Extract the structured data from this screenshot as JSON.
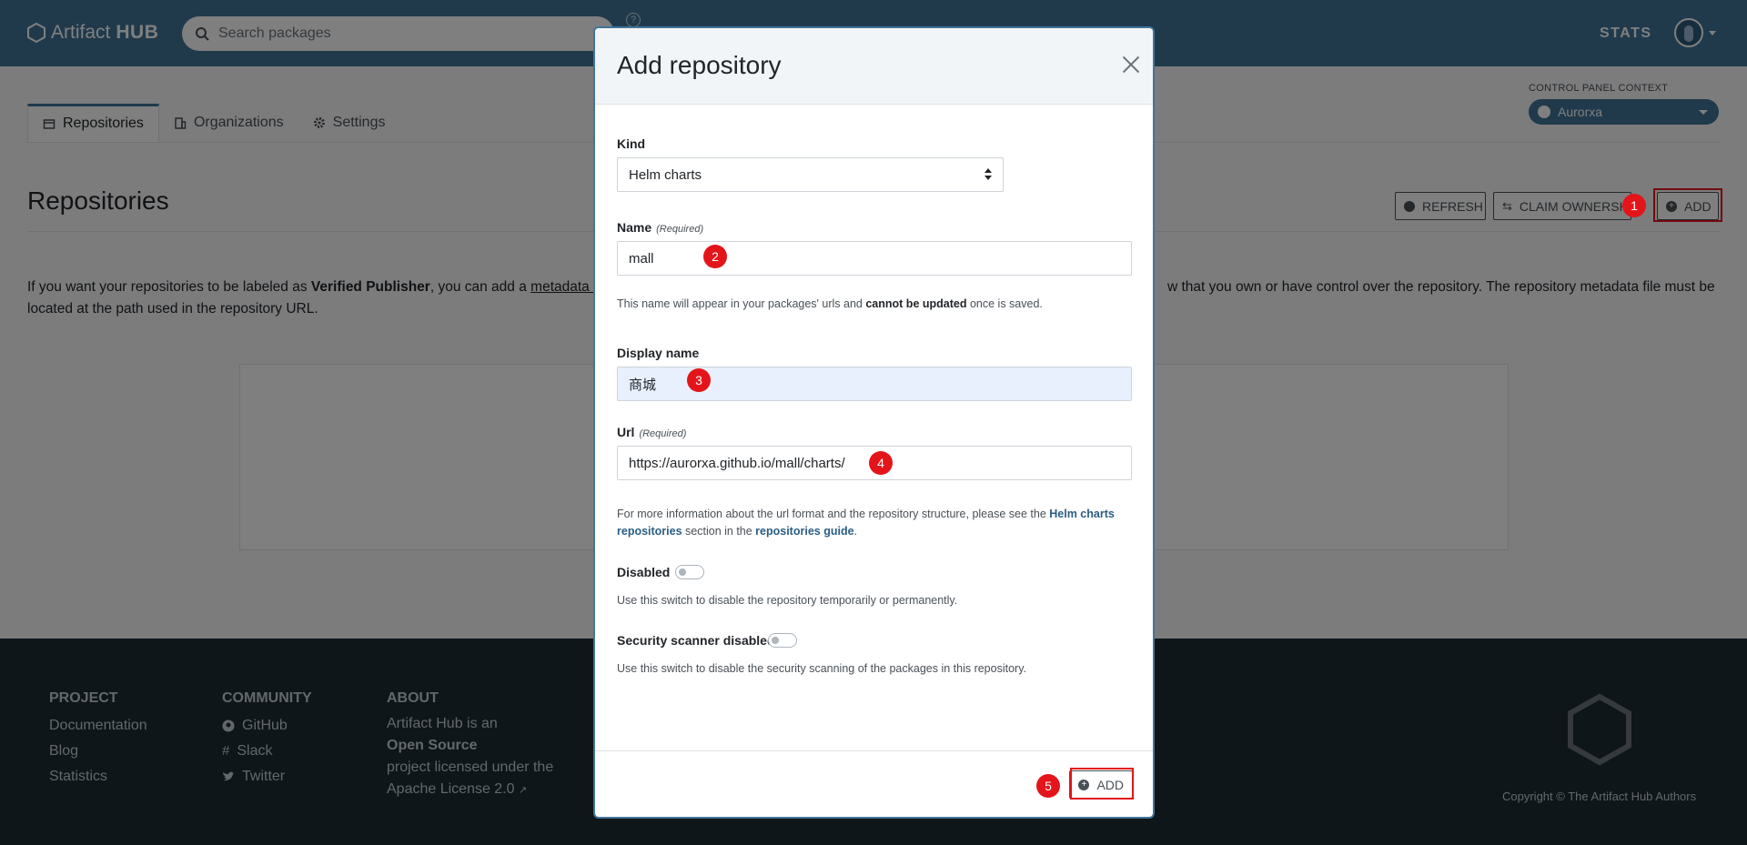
{
  "header": {
    "logo_text": "Artifact",
    "logo_bold": "HUB",
    "search_placeholder": "Search packages",
    "help_symbol": "?",
    "stats_label": "STATS"
  },
  "tabs": [
    {
      "label": "Repositories",
      "icon": "package-icon"
    },
    {
      "label": "Organizations",
      "icon": "building-icon"
    },
    {
      "label": "Settings",
      "icon": "gear-icon"
    }
  ],
  "context": {
    "label": "CONTROL PANEL CONTEXT",
    "value": "Aurorxa"
  },
  "page": {
    "title": "Repositories",
    "refresh_label": "REFRESH",
    "claim_label": "CLAIM OWNERSHIP",
    "add_label": "ADD",
    "info_prefix": "If you want your repositories to be labeled as ",
    "info_bold": "Verified Publisher",
    "info_middle": ", you can add a ",
    "info_link": "metadata f",
    "info_right": "w that you own or have control over the repository. The repository metadata file must be",
    "info_line2": "located at the path used in the repository URL."
  },
  "annotations": [
    "1",
    "2",
    "3",
    "4",
    "5"
  ],
  "modal": {
    "title": "Add repository",
    "kind": {
      "label": "Kind",
      "value": "Helm charts"
    },
    "name": {
      "label": "Name",
      "required": "(Required)",
      "value": "mall",
      "help_prefix": "This name will appear in your packages' urls and ",
      "help_bold": "cannot be updated",
      "help_suffix": " once is saved."
    },
    "display_name": {
      "label": "Display name",
      "value": "商城"
    },
    "url": {
      "label": "Url",
      "required": "(Required)",
      "value": "https://aurorxa.github.io/mall/charts/",
      "help_prefix": "For more information about the url format and the repository structure, please see the ",
      "help_link1": "Helm charts repositories",
      "help_middle": " section in the ",
      "help_link2": "repositories guide",
      "help_suffix": "."
    },
    "disabled": {
      "label": "Disabled",
      "help": "Use this switch to disable the repository temporarily or permanently.",
      "checked": false
    },
    "security": {
      "label": "Security scanner disabled",
      "help": "Use this switch to disable the security scanning of the packages in this repository.",
      "checked": false
    },
    "add_label": "ADD"
  },
  "footer": {
    "project": {
      "title": "PROJECT",
      "items": [
        "Documentation",
        "Blog",
        "Statistics"
      ]
    },
    "community": {
      "title": "COMMUNITY",
      "items": [
        {
          "label": "GitHub",
          "icon": "github-icon"
        },
        {
          "label": "Slack",
          "icon": "slack-icon"
        },
        {
          "label": "Twitter",
          "icon": "twitter-icon"
        }
      ]
    },
    "about": {
      "title": "ABOUT",
      "line1": "Artifact Hub is an",
      "bold": "Open Source",
      "line2": "project licensed under the",
      "line3": "Apache License 2.0"
    },
    "copyright": "Copyright © The Artifact Hub Authors"
  }
}
